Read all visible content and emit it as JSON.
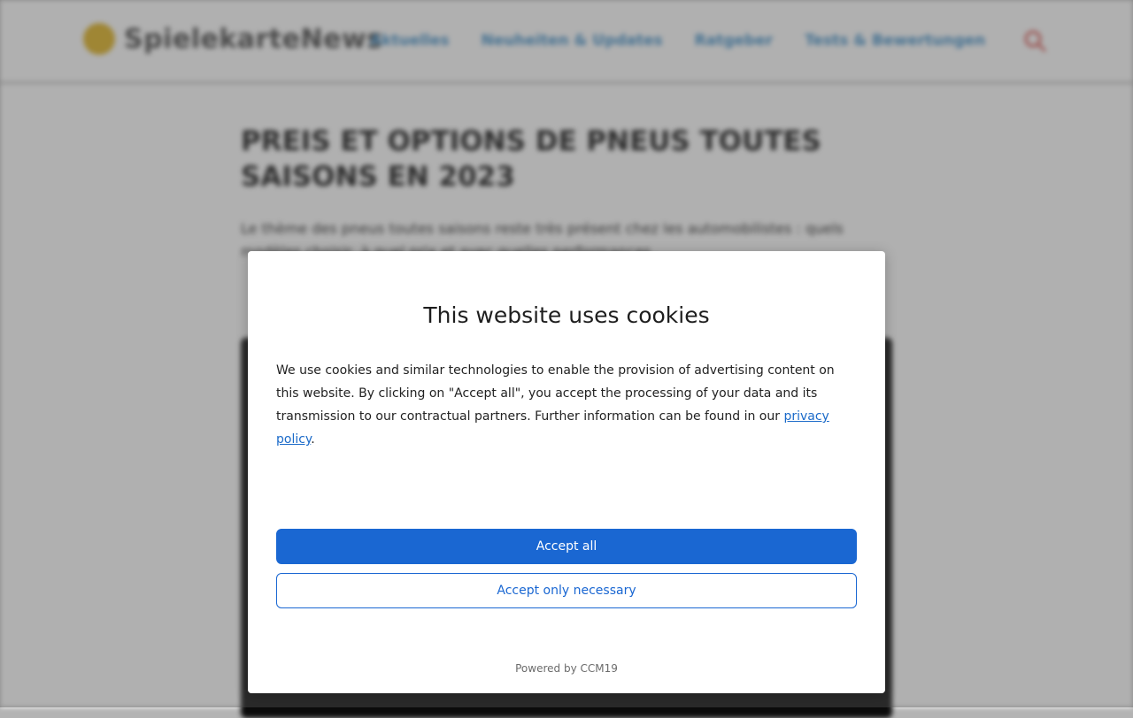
{
  "background": {
    "logo_text": "SpielekarteNews",
    "nav": [
      {
        "label": "Aktuelles"
      },
      {
        "label": "Neuheiten & Updates"
      },
      {
        "label": "Ratgeber"
      },
      {
        "label": "Tests & Bewertungen"
      }
    ],
    "article": {
      "title": "PREIS ET OPTIONS DE PNEUS TOUTES SAISONS EN 2023",
      "lead": "Le thème des pneus toutes saisons reste très présent chez les automobilistes : quels modèles choisir, à quel prix et avec quelles performances."
    }
  },
  "cookie_dialog": {
    "title": "This website uses cookies",
    "body_prefix": "We use cookies and similar technologies to enable the provision of advertising content on this website. By clicking on \"Accept all\", you accept the processing of your data and its transmission to our contractual partners. Further information can be found in our ",
    "privacy_link": "privacy policy",
    "body_suffix": ".",
    "accept_all": "Accept all",
    "accept_necessary": "Accept only necessary",
    "powered_by": "Powered by CCM19"
  },
  "colors": {
    "primary": "#1a67d2",
    "link": "#1a6ac9",
    "nav": "#3b8cc7",
    "logo_accent": "#e0b21e"
  },
  "icons": {
    "search": "search-icon",
    "logo": "logo-icon"
  }
}
